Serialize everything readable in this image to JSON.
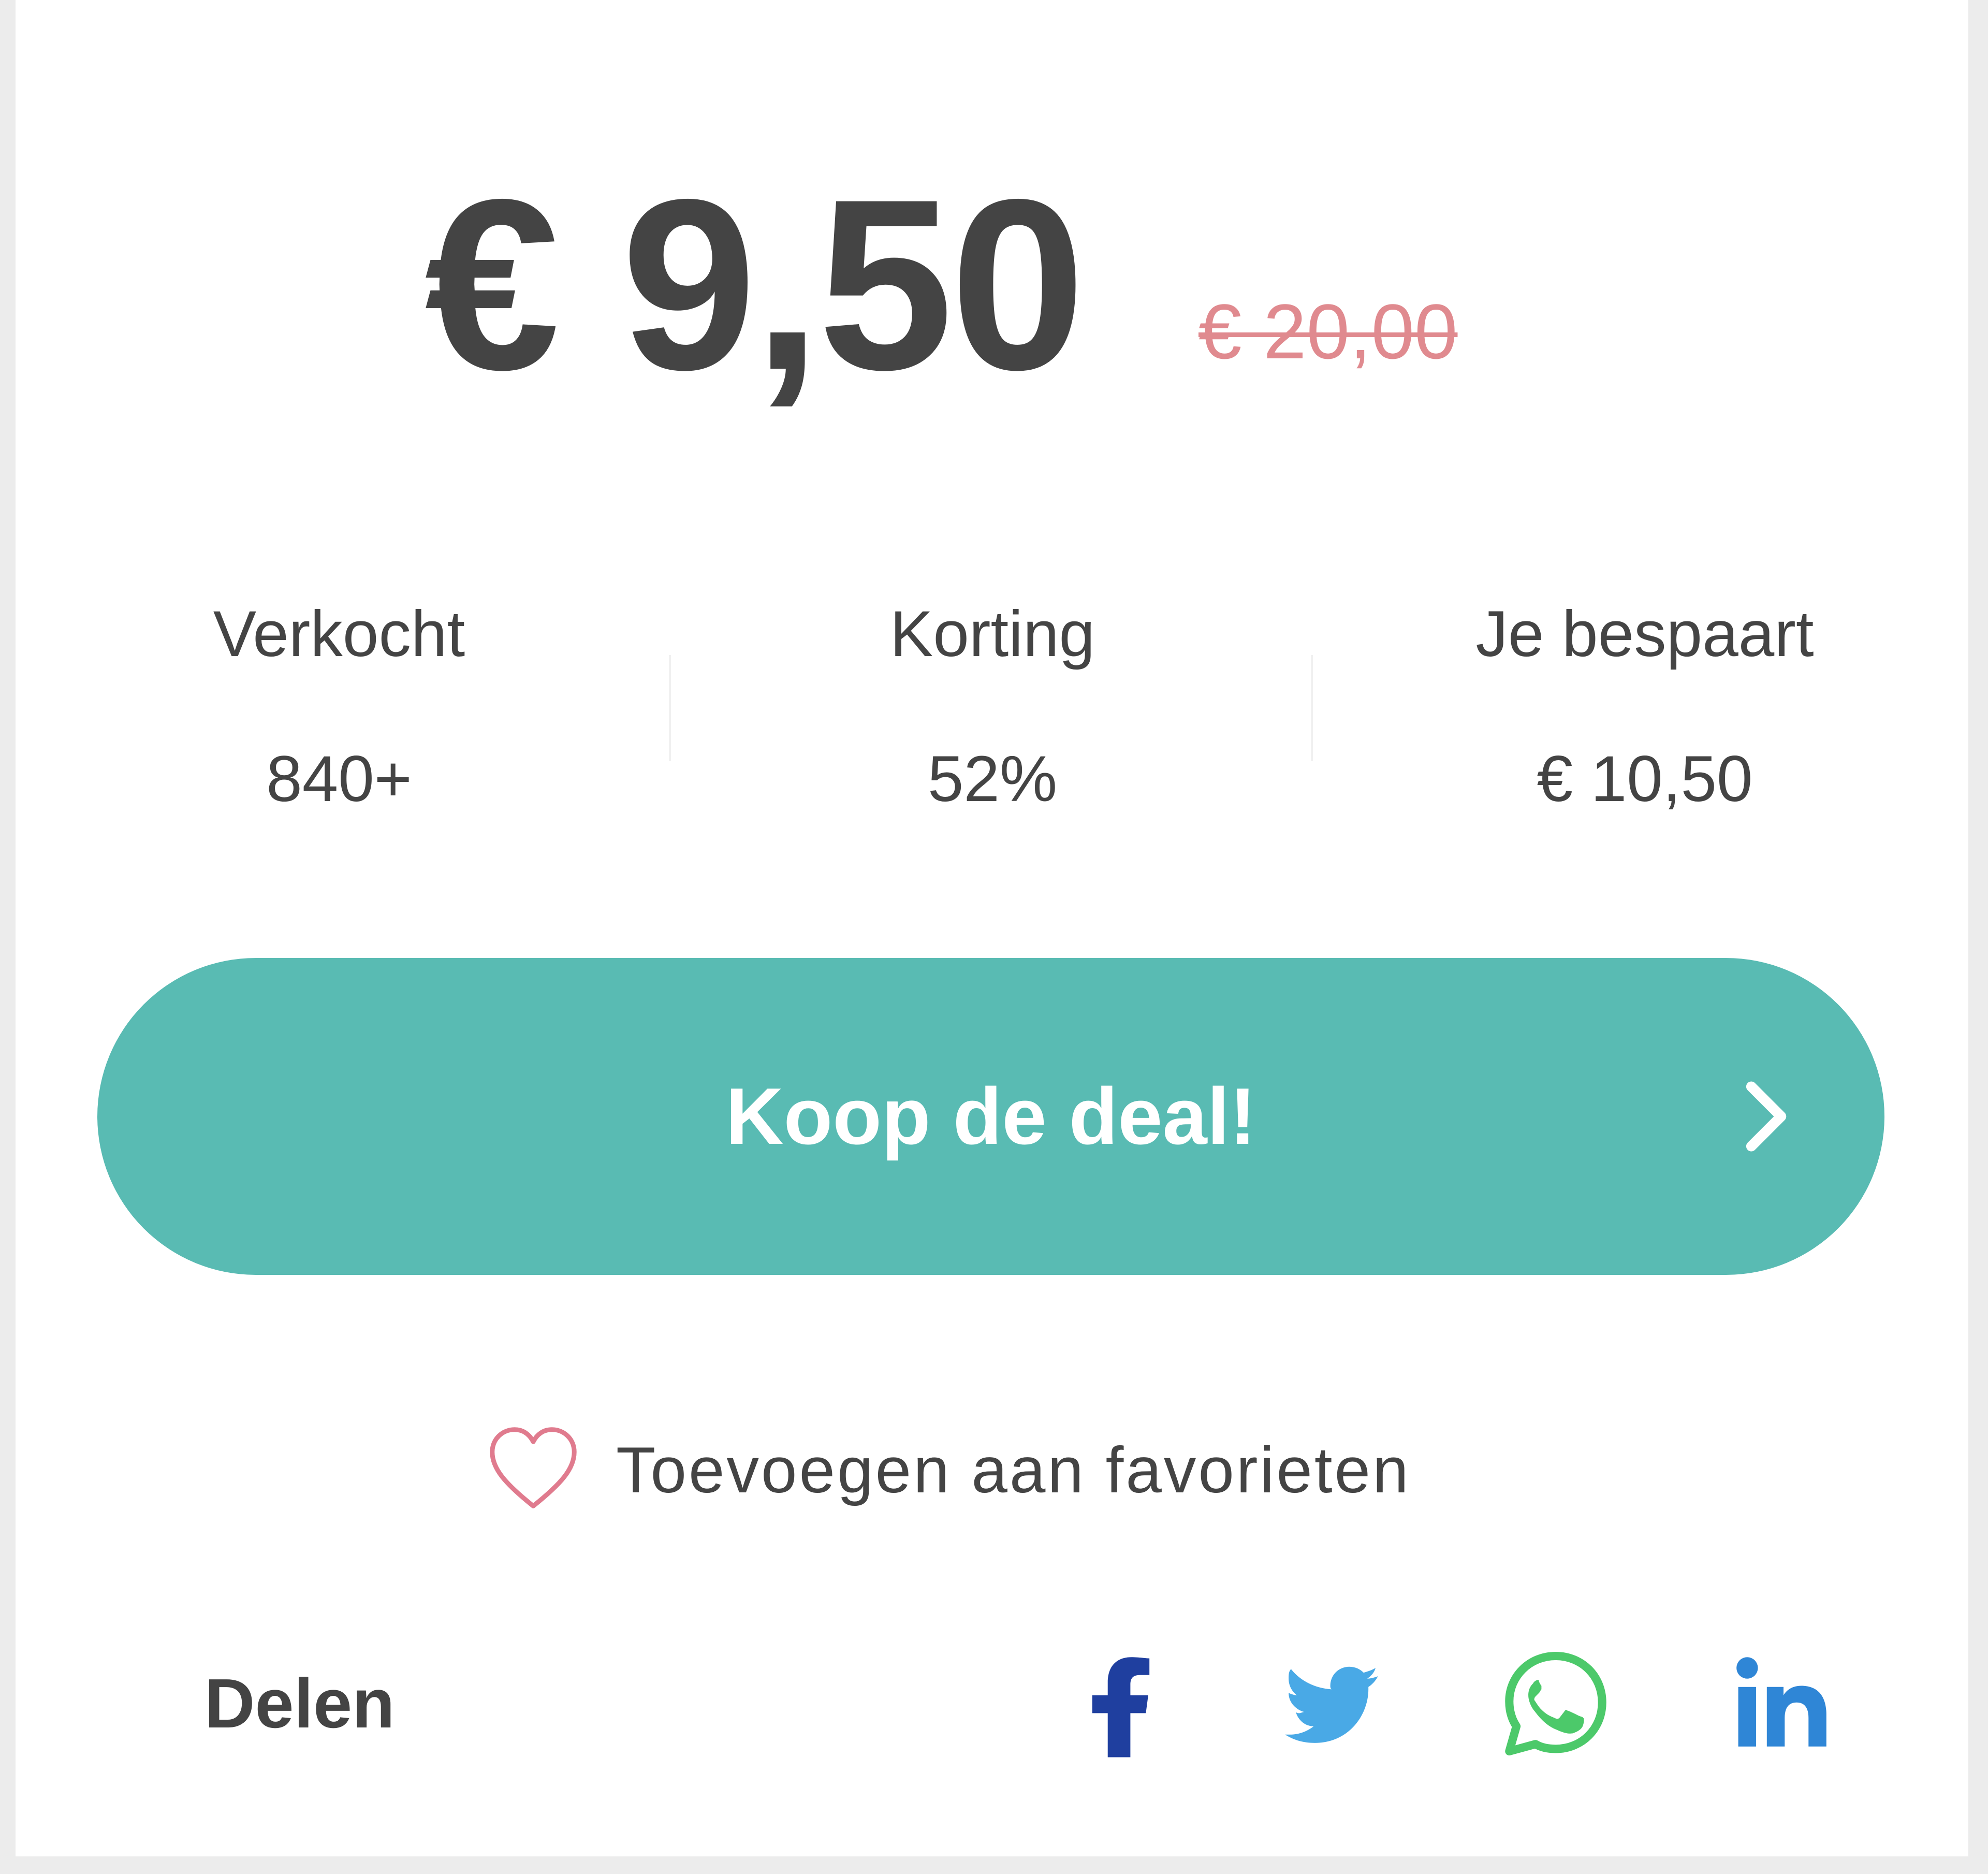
{
  "price": {
    "current": "€ 9,50",
    "original": "€ 20,00"
  },
  "stats": [
    {
      "label": "Verkocht",
      "value": "840+"
    },
    {
      "label": "Korting",
      "value": "52%"
    },
    {
      "label": "Je bespaart",
      "value": "€ 10,50"
    }
  ],
  "cta": {
    "label": "Koop de deal!",
    "icon": "chevron-right-icon",
    "color": "#59bbb3"
  },
  "favorite": {
    "label": "Toevoegen aan favorieten",
    "icon": "heart-icon",
    "icon_color": "#e07b8e"
  },
  "share": {
    "label": "Delen",
    "icons": [
      {
        "name": "facebook-icon",
        "color": "#1f3f9f"
      },
      {
        "name": "twitter-icon",
        "color": "#49a9e6"
      },
      {
        "name": "whatsapp-icon",
        "color": "#4cc96a"
      },
      {
        "name": "linkedin-icon",
        "color": "#2f86d6"
      }
    ]
  },
  "colors": {
    "text": "#444444",
    "old_price": "#e08a8f"
  }
}
